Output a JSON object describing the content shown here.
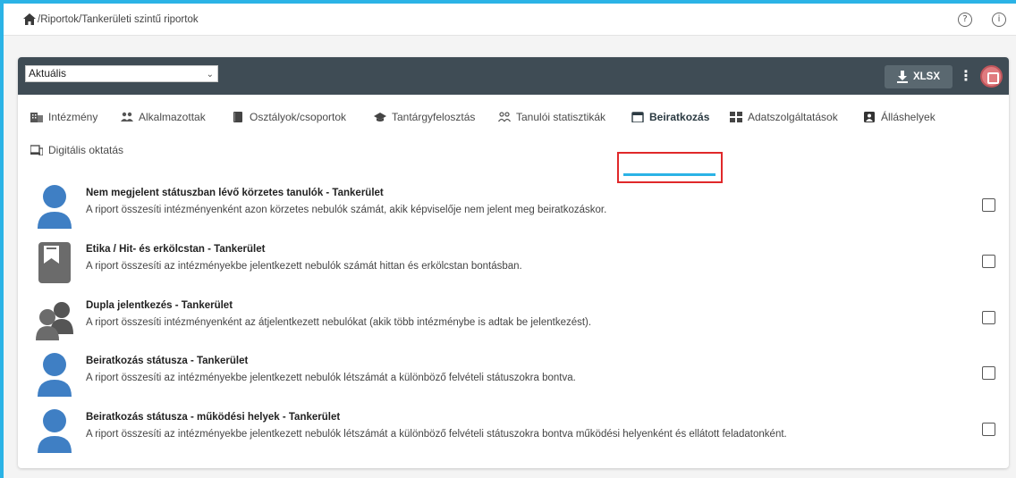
{
  "breadcrumb": "/Riportok/Tankerületi szintű riportok",
  "toolbar": {
    "select_value": "Aktuális",
    "export_label": "XLSX"
  },
  "tabs": [
    {
      "label": "Intézmény",
      "icon": "building-icon"
    },
    {
      "label": "Alkalmazottak",
      "icon": "people-icon"
    },
    {
      "label": "Osztályok/csoportok",
      "icon": "book-icon"
    },
    {
      "label": "Tantárgyfelosztás",
      "icon": "graduation-cap-icon"
    },
    {
      "label": "Tanulói statisztikák",
      "icon": "group-outline-icon"
    },
    {
      "label": "Beiratkozás",
      "icon": "calendar-icon"
    },
    {
      "label": "Adatszolgáltatások",
      "icon": "grid-icon"
    },
    {
      "label": "Álláshelyek",
      "icon": "badge-icon"
    },
    {
      "label": "Digitális oktatás",
      "icon": "devices-icon"
    }
  ],
  "active_tab": "Beiratkozás",
  "reports": [
    {
      "title": "Nem megjelent státuszban lévő körzetes tanulók - Tankerület",
      "description": "A riport összesíti intézményenként azon körzetes nebulók számát, akik képviselője nem jelent meg beiratkozáskor.",
      "icon": "person-icon"
    },
    {
      "title": "Etika / Hit- és erkölcstan - Tankerület",
      "description": "A riport összesíti az intézményekbe jelentkezett nebulók számát hittan és erkölcstan bontásban.",
      "icon": "bookmark-icon"
    },
    {
      "title": "Dupla jelentkezés - Tankerület",
      "description": "A riport összesíti intézményenként az átjelentkezett nebulókat (akik több intézménybe is adtak be jelentkezést).",
      "icon": "people-group-icon"
    },
    {
      "title": "Beiratkozás státusza - Tankerület",
      "description": "A riport összesíti az intézményekbe jelentkezett nebulók létszámát a különböző felvételi státuszokra bontva.",
      "icon": "person-icon"
    },
    {
      "title": "Beiratkozás státusza - működési helyek - Tankerület",
      "description": "A riport összesíti az intézményekbe jelentkezett nebulók létszámát a különböző felvételi státuszokra bontva működési helyenként és ellátott feladatonként.",
      "icon": "person-icon"
    }
  ],
  "colors": {
    "accent": "#2bb3e6",
    "toolbar": "#3f4c55",
    "highlight": "#e0282a",
    "avatar": "#3f7fc4"
  }
}
